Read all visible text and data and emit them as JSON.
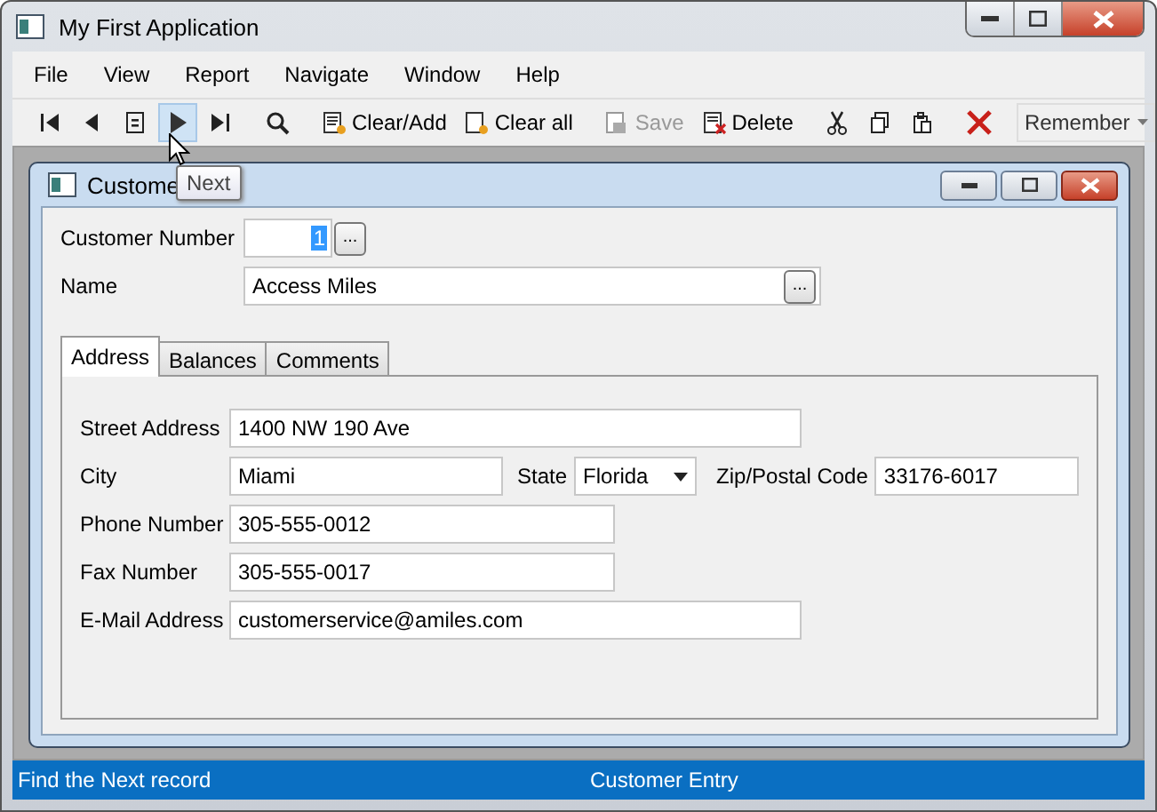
{
  "window": {
    "title": "My First Application"
  },
  "menu": [
    {
      "label": "File"
    },
    {
      "label": "View"
    },
    {
      "label": "Report"
    },
    {
      "label": "Navigate"
    },
    {
      "label": "Window"
    },
    {
      "label": "Help"
    }
  ],
  "toolbar": {
    "nav": [
      {
        "hovered": false
      },
      {
        "hovered": false
      },
      {
        "hovered": false
      },
      {
        "hovered": true
      },
      {
        "hovered": false
      }
    ],
    "buttons": [
      {
        "label": "Clear/Add",
        "disabled": false
      },
      {
        "label": "Clear all",
        "disabled": false
      },
      {
        "label": "Save",
        "disabled": true
      },
      {
        "label": "Delete",
        "disabled": false
      }
    ],
    "dropdown": "Remember"
  },
  "tooltip": "Next",
  "child_window": {
    "title": "Custome",
    "customer_number": {
      "label": "Customer Number",
      "value": "1",
      "lookup": "..."
    },
    "name": {
      "label": "Name",
      "value": "Access Miles",
      "lookup": "..."
    },
    "tabs": [
      {
        "label": "Address",
        "selected": true
      },
      {
        "label": "Balances",
        "selected": false
      },
      {
        "label": "Comments",
        "selected": false
      }
    ],
    "address": {
      "street": {
        "label": "Street Address",
        "value": "1400 NW 190 Ave"
      },
      "city": {
        "label": "City",
        "value": "Miami"
      },
      "state": {
        "label": "State",
        "value": "Florida"
      },
      "zip": {
        "label": "Zip/Postal Code",
        "value": "33176-6017"
      },
      "phone": {
        "label": "Phone Number",
        "value": "305-555-0012"
      },
      "fax": {
        "label": "Fax Number",
        "value": "305-555-0017"
      },
      "email": {
        "label": "E-Mail Address",
        "value": "customerservice@amiles.com"
      }
    }
  },
  "status_bar": {
    "message": "Find the Next record",
    "form": "Customer Entry"
  }
}
